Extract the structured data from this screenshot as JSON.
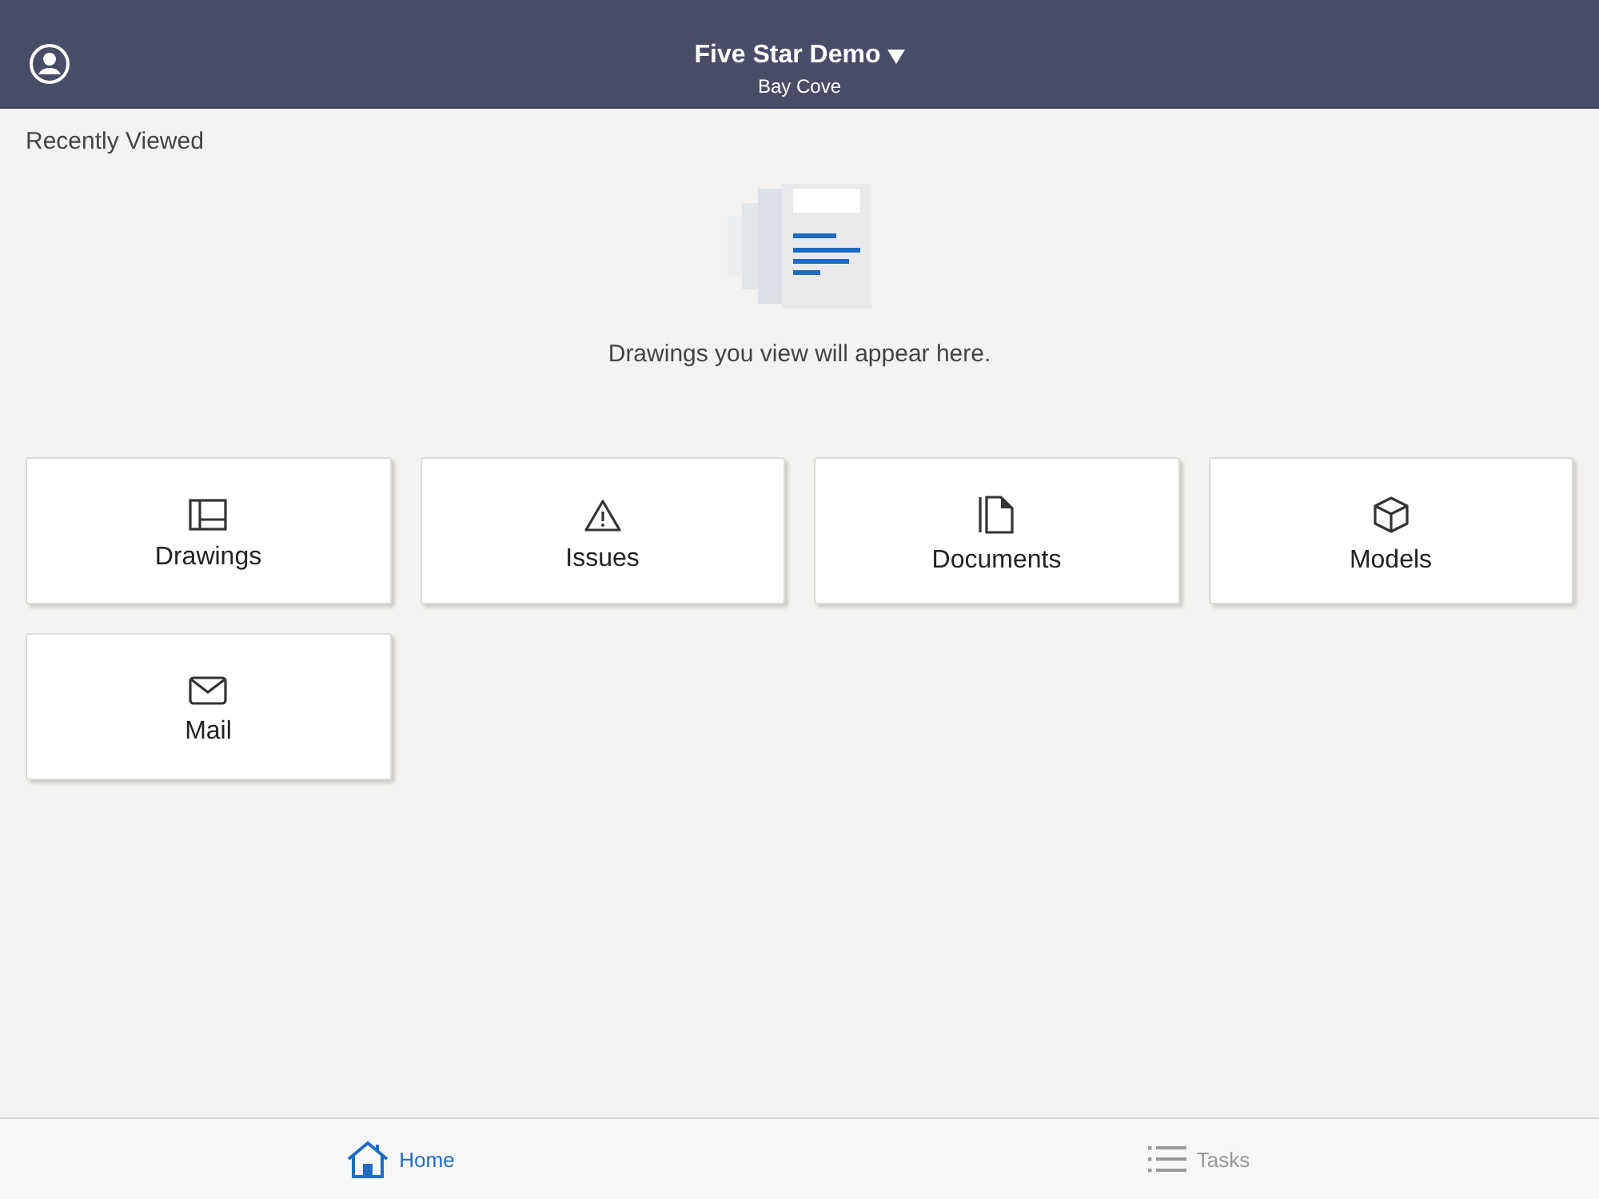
{
  "header": {
    "title": "Five Star Demo",
    "subtitle": "Bay Cove"
  },
  "recently_viewed": {
    "heading": "Recently Viewed",
    "empty_message": "Drawings you view will appear here."
  },
  "tiles": [
    {
      "label": "Drawings",
      "kind": "drawings"
    },
    {
      "label": "Issues",
      "kind": "issues"
    },
    {
      "label": "Documents",
      "kind": "documents"
    },
    {
      "label": "Models",
      "kind": "models"
    },
    {
      "label": "Mail",
      "kind": "mail"
    }
  ],
  "tab_bar": [
    {
      "label": "Home",
      "kind": "home",
      "selected": true
    },
    {
      "label": "Tasks",
      "kind": "tasks",
      "selected": false
    }
  ]
}
